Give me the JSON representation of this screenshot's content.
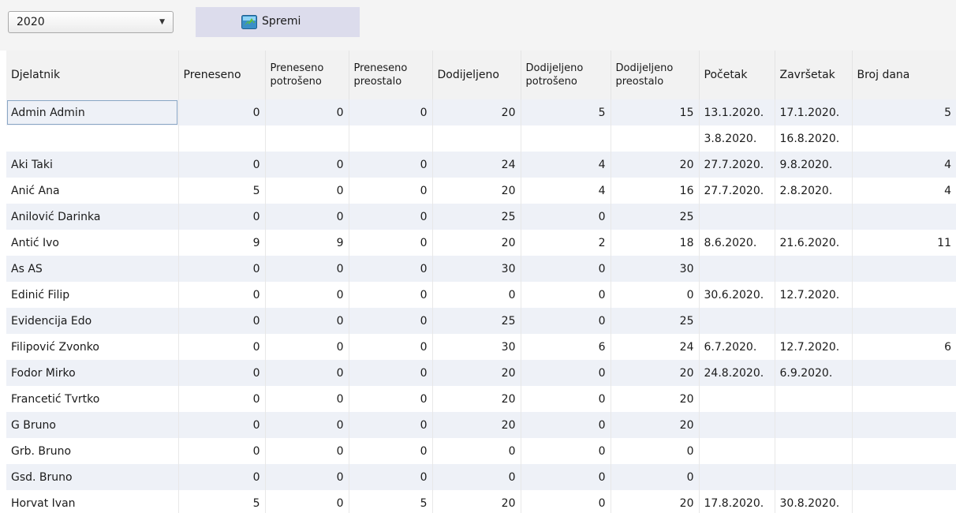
{
  "toolbar": {
    "year_value": "2020",
    "dropdown_arrow": "▼",
    "save_label": "Spremi",
    "save_icon": "save-icon"
  },
  "grid": {
    "headers": [
      "Djelatnik",
      "Preneseno",
      "Preneseno potrošeno",
      "Preneseno preostalo",
      "Dodijeljeno",
      "Dodijeljeno potrošeno",
      "Dodijeljeno preostalo",
      "Početak",
      "Završetak",
      "Broj dana"
    ],
    "rows": [
      [
        "Admin Admin",
        "0",
        "0",
        "0",
        "20",
        "5",
        "15",
        "13.1.2020.",
        "17.1.2020.",
        "5"
      ],
      [
        "",
        "",
        "",
        "",
        "",
        "",
        "",
        "3.8.2020.",
        "16.8.2020.",
        ""
      ],
      [
        "Aki Taki",
        "0",
        "0",
        "0",
        "24",
        "4",
        "20",
        "27.7.2020.",
        "9.8.2020.",
        "4"
      ],
      [
        "Anić Ana",
        "5",
        "0",
        "0",
        "20",
        "4",
        "16",
        "27.7.2020.",
        "2.8.2020.",
        "4"
      ],
      [
        "Anilović Darinka",
        "0",
        "0",
        "0",
        "25",
        "0",
        "25",
        "",
        "",
        ""
      ],
      [
        "Antić Ivo",
        "9",
        "9",
        "0",
        "20",
        "2",
        "18",
        "8.6.2020.",
        "21.6.2020.",
        "11"
      ],
      [
        "As AS",
        "0",
        "0",
        "0",
        "30",
        "0",
        "30",
        "",
        "",
        ""
      ],
      [
        "Edinić Filip",
        "0",
        "0",
        "0",
        "0",
        "0",
        "0",
        "30.6.2020.",
        "12.7.2020.",
        ""
      ],
      [
        "Evidencija Edo",
        "0",
        "0",
        "0",
        "25",
        "0",
        "25",
        "",
        "",
        ""
      ],
      [
        "Filipović Zvonko",
        "0",
        "0",
        "0",
        "30",
        "6",
        "24",
        "6.7.2020.",
        "12.7.2020.",
        "6"
      ],
      [
        "Fodor Mirko",
        "0",
        "0",
        "0",
        "20",
        "0",
        "20",
        "24.8.2020.",
        "6.9.2020.",
        ""
      ],
      [
        "Francetić Tvrtko",
        "0",
        "0",
        "0",
        "20",
        "0",
        "20",
        "",
        "",
        ""
      ],
      [
        "G Bruno",
        "0",
        "0",
        "0",
        "20",
        "0",
        "20",
        "",
        "",
        ""
      ],
      [
        "Grb. Bruno",
        "0",
        "0",
        "0",
        "0",
        "0",
        "0",
        "",
        "",
        ""
      ],
      [
        "Gsd. Bruno",
        "0",
        "0",
        "0",
        "0",
        "0",
        "0",
        "",
        "",
        ""
      ],
      [
        "Horvat Ivan",
        "5",
        "0",
        "5",
        "20",
        "0",
        "20",
        "17.8.2020.",
        "30.8.2020.",
        ""
      ]
    ]
  }
}
